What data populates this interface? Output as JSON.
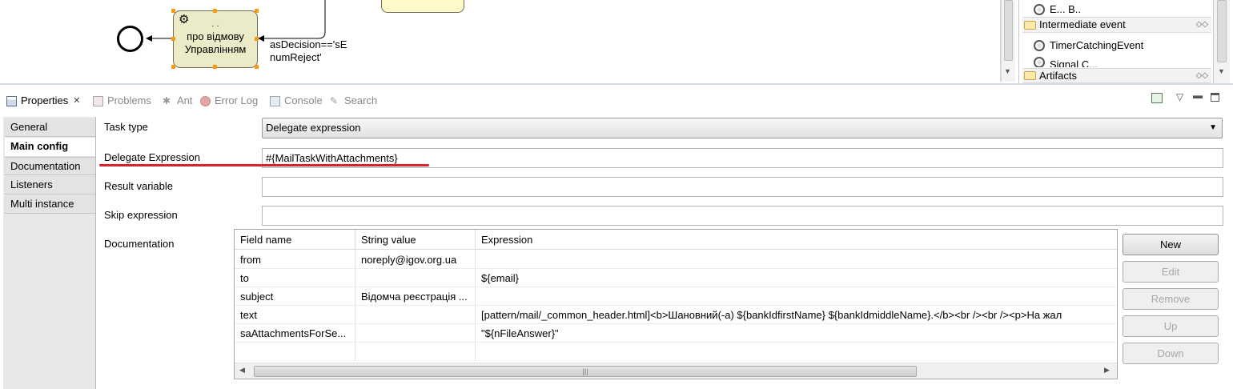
{
  "diagram": {
    "task_label": "про відмову Управлінням",
    "task_label_top": "· ·",
    "flow_label": "asDecision=='sEnumReject'",
    "flow_label_line1": "asDecision=='sE",
    "flow_label_line2": "numReject'"
  },
  "palette": {
    "items": [
      {
        "label": "Е... В..",
        "type": "event"
      },
      {
        "label": "Intermediate event",
        "type": "group"
      },
      {
        "label": "TimerCatchingEvent",
        "type": "event"
      },
      {
        "label": "Signal C...",
        "type": "event"
      },
      {
        "label": "Artifacts",
        "type": "group"
      }
    ]
  },
  "tabs": [
    {
      "label": "Properties",
      "active": true,
      "icon": "properties-icon"
    },
    {
      "label": "Problems",
      "active": false,
      "icon": "problems-icon"
    },
    {
      "label": "Ant",
      "active": false,
      "icon": "ant-icon"
    },
    {
      "label": "Error Log",
      "active": false,
      "icon": "error-log-icon"
    },
    {
      "label": "Console",
      "active": false,
      "icon": "console-icon"
    },
    {
      "label": "Search",
      "active": false,
      "icon": "search-icon"
    }
  ],
  "categories": [
    "General",
    "Main config",
    "Documentation",
    "Listeners",
    "Multi instance"
  ],
  "selected_category": "Main config",
  "form": {
    "task_type_label": "Task type",
    "task_type_value": "Delegate expression",
    "delegate_label": "Delegate Expression",
    "delegate_value": "#{MailTaskWithAttachments}",
    "result_label": "Result variable",
    "result_value": "",
    "skip_label": "Skip expression",
    "skip_value": "",
    "documentation_label": "Documentation"
  },
  "fields_table": {
    "columns": [
      "Field name",
      "String value",
      "Expression"
    ],
    "rows": [
      {
        "name": "from",
        "string": "noreply@igov.org.ua",
        "expr": ""
      },
      {
        "name": "to",
        "string": "",
        "expr": "${email}"
      },
      {
        "name": "subject",
        "string": "Відомча реєстрація ...",
        "expr": ""
      },
      {
        "name": "text",
        "string": "",
        "expr": "[pattern/mail/_common_header.html]<b>Шановний(-а) ${bankIdfirstName} ${bankIdmiddleName}.</b><br /><br /><p>На жал"
      },
      {
        "name": "saAttachmentsForSe...",
        "string": "",
        "expr": "\"${nFileAnswer}\""
      }
    ]
  },
  "buttons": {
    "new": "New",
    "edit": "Edit",
    "remove": "Remove",
    "up": "Up",
    "down": "Down"
  },
  "colors": {
    "task_fill": "#ecebc7",
    "handle": "#f39c12",
    "underline": "#d9222a"
  }
}
